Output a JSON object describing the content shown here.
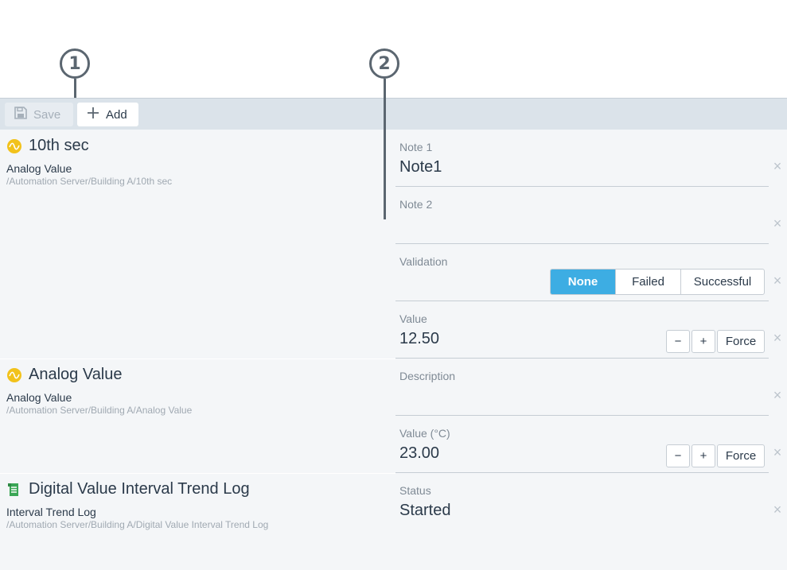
{
  "callouts": [
    "1",
    "2"
  ],
  "toolbar": {
    "save_label": "Save",
    "add_label": "Add"
  },
  "objects": [
    {
      "title": "10th sec",
      "type": "Analog Value",
      "path": "/Automation Server/Building A/10th sec",
      "icon": "analog-value-icon"
    },
    {
      "title": "Analog Value",
      "type": "Analog Value",
      "path": "/Automation Server/Building A/Analog Value",
      "icon": "analog-value-icon"
    },
    {
      "title": "Digital Value Interval Trend Log",
      "type": "Interval Trend Log",
      "path": "/Automation Server/Building A/Digital Value Interval Trend Log",
      "icon": "trend-log-icon"
    }
  ],
  "fields": {
    "note1": {
      "label": "Note 1",
      "value": "Note1"
    },
    "note2": {
      "label": "Note 2",
      "value": ""
    },
    "validation": {
      "label": "Validation",
      "options": [
        "None",
        "Failed",
        "Successful"
      ],
      "selected": "None"
    },
    "value1": {
      "label": "Value",
      "value": "12.50"
    },
    "description": {
      "label": "Description",
      "value": ""
    },
    "value2": {
      "label": "Value (°C)",
      "value": "23.00"
    },
    "status": {
      "label": "Status",
      "value": "Started"
    }
  },
  "controls": {
    "minus": "−",
    "plus": "+",
    "force": "Force",
    "clear": "×"
  },
  "colors": {
    "accent": "#3dade3",
    "toolbar_bg": "#dbe3ea",
    "content_bg": "#f4f6f8",
    "analog_icon": "#f2c21b",
    "trend_icon": "#3aa655"
  }
}
